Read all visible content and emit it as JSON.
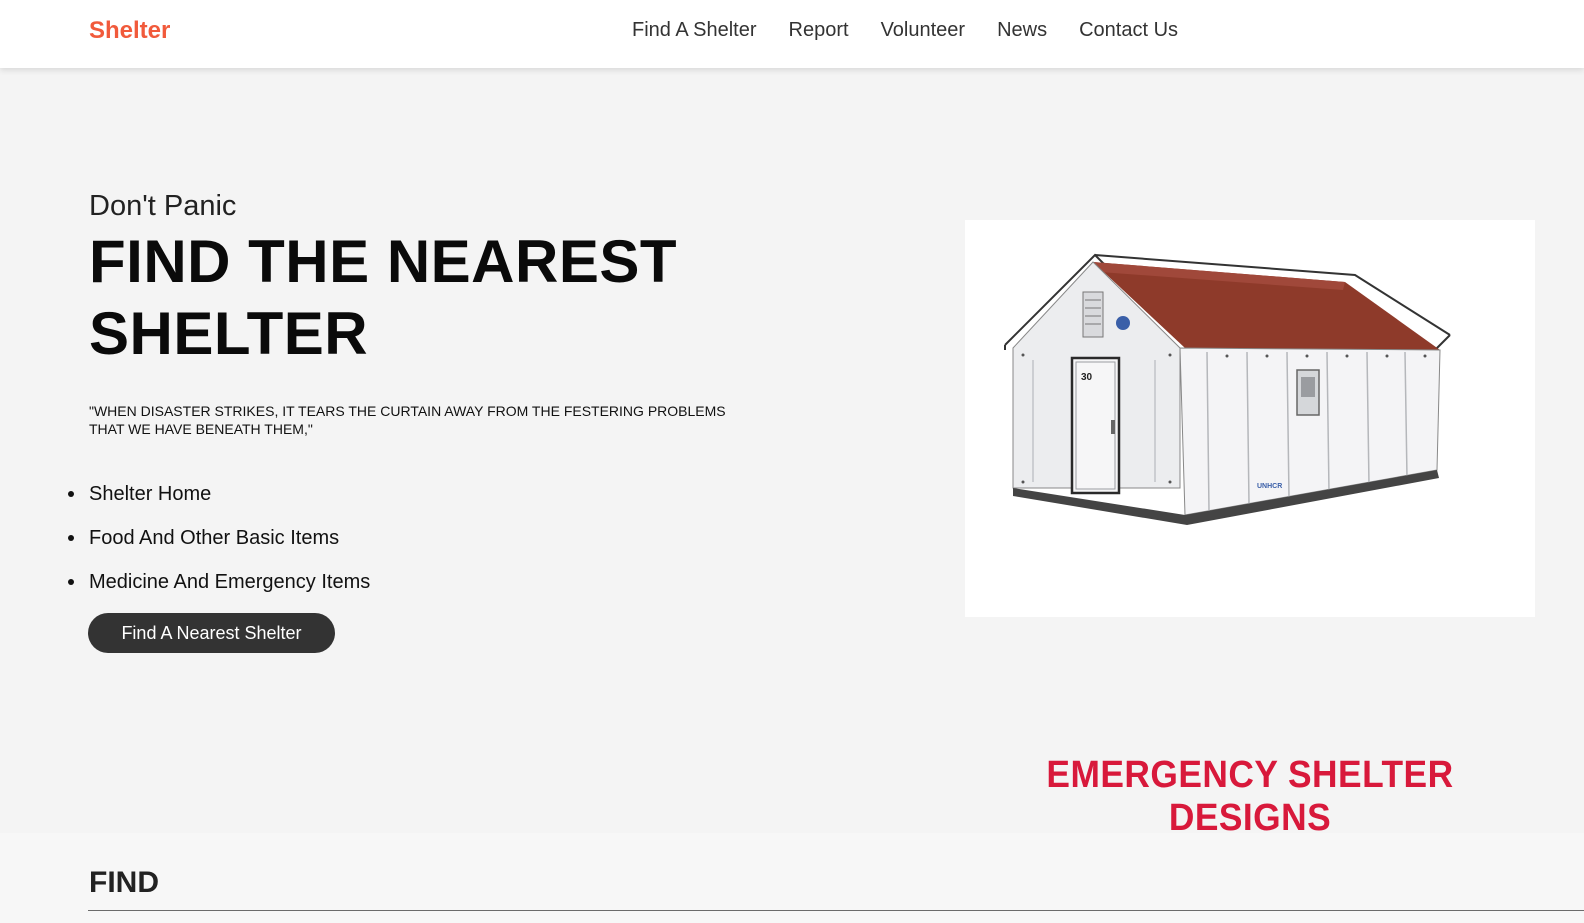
{
  "nav": {
    "brand": "Shelter",
    "links": [
      "Find A Shelter",
      "Report",
      "Volunteer",
      "News",
      "Contact Us"
    ]
  },
  "hero": {
    "subtitle": "Don't Panic",
    "title": "FIND THE NEAREST SHELTER",
    "quote": "\"WHEN DISASTER STRIKES, IT TEARS THE CURTAIN AWAY FROM THE FESTERING PROBLEMS THAT WE HAVE BENEATH THEM,\"",
    "features": [
      "Shelter Home",
      "Food And Other Basic Items",
      "Medicine And Emergency Items"
    ],
    "cta_label": "Find A Nearest Shelter"
  },
  "image": {
    "caption": "EMERGENCY SHELTER DESIGNS",
    "door_number": "30",
    "logo_text": "UNHCR"
  },
  "find_section": {
    "heading": "FIND"
  },
  "colors": {
    "brand": "#f15a3b",
    "background": "#f4f4f4",
    "button": "#333333",
    "caption": "#d8193b",
    "roof": "#8e3a2a"
  }
}
